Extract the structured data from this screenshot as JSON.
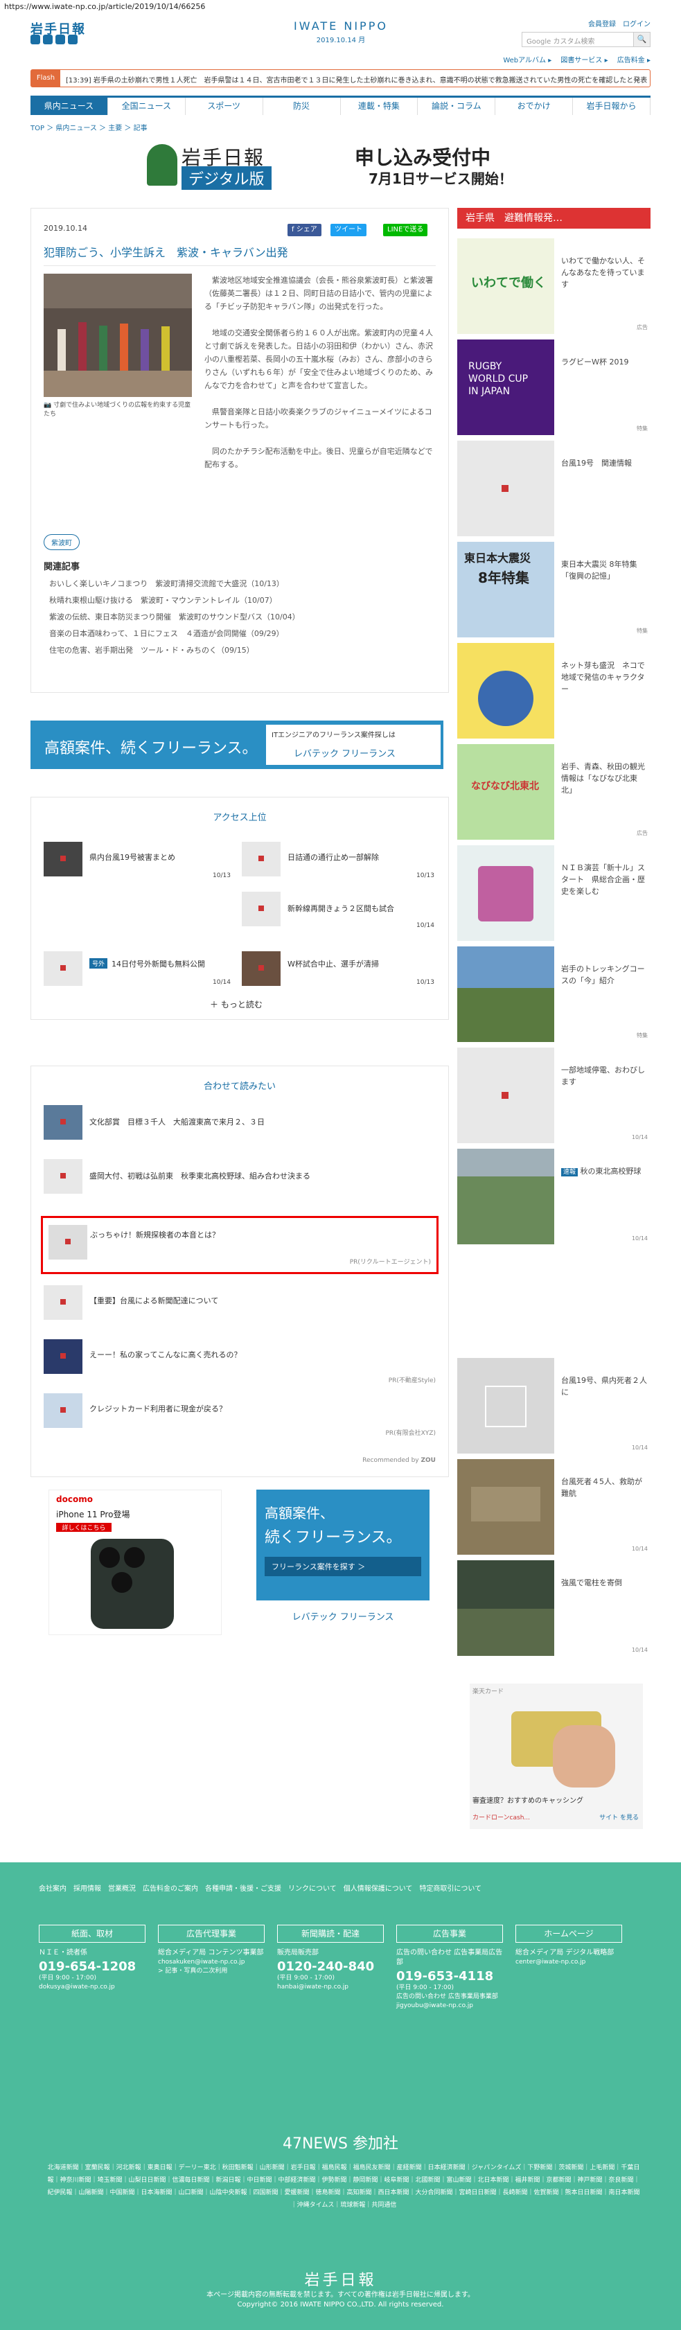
{
  "url": "https://www.iwate-np.co.jp/article/2019/10/14/66256",
  "header": {
    "logo": "岩手日報",
    "center_title": "IWATE NIPPO",
    "center_date": "2019.10.14 月",
    "member": "会員登録",
    "login": "ログイン",
    "search_placeholder": "Google カスタム検索",
    "search_btn": "🔍",
    "subnav": "Webアルバム ▸　 図書サービス ▸　 広告料金 ▸"
  },
  "flash": {
    "tag": "Flash",
    "text": "[13:39] 岩手県の土砂崩れで男性１人死亡　岩手県警は１４日、宮古市田老で１３日に発生した土砂崩れに巻き込まれ、意識不明の状態で救急搬送されていた男性の死亡を確認したと発表した。"
  },
  "nav": [
    "県内ニュース",
    "全国ニュース",
    "スポーツ",
    "防災",
    "連載・特集",
    "論説・コラム",
    "おでかけ",
    "岩手日報から"
  ],
  "breadcrumb": "TOP ＞ 県内ニュース ＞ 主要 ＞ 記事",
  "banner": {
    "left": "岩手日報",
    "left_sub": "デジタル版",
    "right1": "申し込み受付中",
    "right2": "7月1日サービス開始！"
  },
  "article": {
    "date": "2019.10.14",
    "title": "犯罪防ごう、小学生訴え　紫波・キャラバン出発",
    "share_fb": "f シェア",
    "share_tw": "ツイート",
    "share_line": "LINEで送る",
    "caption": "寸劇で住みよい地域づくりの広報を約束する児童たち",
    "body": "　紫波地区地域安全推進協議会（会長・熊谷泉紫波町長）と紫波署（佐藤英二署長）は１２日、同町日詰の日詰小で、管内の児童による「チビッ子防犯キャラバン隊」の出発式を行った。\n\n　地域の交通安全関係者ら約１６０人が出席。紫波町内の児童４人と寸劇で訴えを発表した。日詰小の羽田和伊（わかい）さん、赤沢小の八重樫若菜、長岡小の五十嵐水桜（みお）さん、彦部小のきらりさん（いずれも６年）が「安全で住みよい地域づくりのため、みんなで力を合わせて」と声を合わせて宣言した。\n\n　県警音楽隊と日詰小吹奏楽クラブのジャイニューメイツによるコンサートも行った。\n\n　同のたかチラシ配布活動を中止。後日、児童らが自宅近隣などで配布する。",
    "tag": "紫波町",
    "related_h": "関連記事",
    "related": [
      "おいしく楽しいキノコまつり　紫波町清掃交流館で大盛況（10/13）",
      "秋晴れ東根山駆け抜ける　紫波町・マウンテントレイル（10/07）",
      "紫波の伝統、東日本防災まつり開催　紫波町のサウンド型バス（10/04）",
      "音楽の日本酒味わって、１日にフェス　４酒造が会同開催（09/29）",
      "住宅の危害、岩手期出発　ツール・ド・みちのく（09/15）"
    ]
  },
  "ad1": {
    "text": "高額案件、続くフリーランス。",
    "right": "ITエンジニアのフリーランス案件探しは",
    "brand": "レバテック フリーランス"
  },
  "ranking": {
    "title": "アクセス上位",
    "items": [
      {
        "t": "県内台風19号被害まとめ",
        "d": "10/13"
      },
      {
        "t": "日詰通の通行止め一部解除",
        "d": "10/13"
      },
      {
        "t": "新幹線再開きょう２区間も試合",
        "d": "10/14"
      },
      {
        "t": "14日付号外新聞も無料公開",
        "d": "10/14"
      },
      {
        "t": "W杯試合中止、選手が清掃",
        "d": "10/13"
      }
    ],
    "more": "＋ もっと読む",
    "new_badge": "号外"
  },
  "recommend": {
    "title": "合わせて読みたい",
    "items": [
      {
        "t": "文化部賞　目標３千人　大船渡東高で来月２、３日"
      },
      {
        "t": "盛岡大付、初戦は弘前東　秋季東北高校野球、組み合わせ決まる"
      },
      {
        "t": "ぶっちゃけ！新規探検者の本音とは？",
        "pr": "PR(リクルートエージェント)"
      },
      {
        "t": "【重要】台風による新聞配達について"
      },
      {
        "t": "えーー！私の家ってこんなに高く売れるの？",
        "pr": "PR(不動産Style)"
      },
      {
        "t": "クレジットカード利用者に現金が戻る？",
        "pr": "PR(有限会社XYZ)"
      }
    ],
    "credit": "Recommended by",
    "credit_brand": "ZOU"
  },
  "ad_docomo": {
    "brand": "docomo",
    "title": "iPhone 11 Pro登場",
    "btn": "詳しくはこちら"
  },
  "ad2": {
    "t1": "高額案件、",
    "t2": "続くフリーランス。",
    "btn": "フリーランス案件を探す ＞",
    "brand": "レバテック フリーランス"
  },
  "sidebar": {
    "header": "岩手県　避難情報発…",
    "items": [
      {
        "t": "いわてで働かない人、そんなあなたを待っています",
        "tag": "広告",
        "img": "iwate"
      },
      {
        "t": "ラグビーＷ杯 2019",
        "tag": "特集",
        "img": "rugby"
      },
      {
        "t": "台風19号　関連情報",
        "tag": "",
        "img": "blank"
      },
      {
        "t": "東日本大震災 8年特集「復興の記憶」",
        "tag": "特集",
        "img": "shinsai"
      },
      {
        "t": "ネット芽も盛況　ネコで地域で発信のキャラクター",
        "tag": "",
        "img": "iwa"
      },
      {
        "t": "岩手、青森、秋田の観光情報は「なびなび北東北」",
        "tag": "広告",
        "img": "navi"
      },
      {
        "t": "ＮＩＢ演芸「新十ル」スタート　県総合企画・歴史を楽しむ",
        "tag": "",
        "img": "nib"
      },
      {
        "t": "岩手のトレッキングコースの「今」紹介",
        "tag": "特集",
        "img": "mountain"
      },
      {
        "t": "一部地域停電、おわびします",
        "tag": "",
        "date": "10/14",
        "img": "blank"
      },
      {
        "t": "秋の東北高校野球",
        "tag": "速報",
        "date": "10/14",
        "img": "baseball"
      },
      {
        "t": "台風19号、県内死者２人に",
        "tag": "",
        "date": "10/14",
        "img": "logo"
      },
      {
        "t": "台風死者４5人、救助が難航",
        "tag": "",
        "date": "10/14",
        "img": "flood"
      },
      {
        "t": "強風で電柱を寄倒",
        "tag": "",
        "date": "10/14",
        "img": "road"
      }
    ]
  },
  "sidead": {
    "title": "楽天カード",
    "sub": "審査速度？おすすめのキャッシング",
    "brand": "カードローンcash...",
    "foot": "サイト を見る"
  },
  "footer": {
    "links": "会社案内　採用情報　営業概況　広告料金のご案内　各種申請・後援・ご支援　リンクについて　個人情報保護について　特定商取引について",
    "cols": [
      {
        "h": "紙面、取材",
        "s": "ＮＩＥ・読者係",
        "ph": "019-654-1208",
        "sm": "(平日 9:00 - 17:00)",
        "mail": "dokusya@iwate-np.co.jp"
      },
      {
        "h": "広告代理事業",
        "s": "総合メディア局 コンテンツ事業部",
        "ph": "",
        "sm": "chosakuken@iwate-np.co.jp",
        "mail": "> 記事・写真の二次利用"
      },
      {
        "h": "新聞購読・配達",
        "s": "販売局販売部",
        "ph": "0120-240-840",
        "sm": "(平日 9:00 - 17:00)",
        "mail": "hanbai@iwate-np.co.jp"
      },
      {
        "h": "広告事業",
        "s": "広告の問い合わせ 広告事業局広告部",
        "ph": "019-653-4118",
        "sm": "(平日 9:00 - 17:00)",
        "mail": "広告の問い合わせ 広告事業局事業部 jigyoubu@iwate-np.co.jp"
      },
      {
        "h": "ホームページ",
        "s": "総合メディア局 デジタル戦略部",
        "ph": "",
        "sm": "center@iwate-np.co.jp",
        "mail": ""
      }
    ],
    "news47": "47NEWS 参加社",
    "members": "北海道新聞｜室蘭民報｜河北新報｜東奥日報｜デーリー東北｜秋田魁新報｜山形新聞｜岩手日報｜福島民報｜福島民友新聞｜産経新聞｜日本経済新聞｜ジャパンタイムズ｜下野新聞｜茨城新聞｜上毛新聞｜千葉日報｜神奈川新聞｜埼玉新聞｜山梨日日新聞｜信濃毎日新聞｜新潟日報｜中日新聞｜中部経済新聞｜伊勢新聞｜静岡新聞｜岐阜新聞｜北國新聞｜富山新聞｜北日本新聞｜福井新聞｜京都新聞｜神戸新聞｜奈良新聞｜紀伊民報｜山陽新聞｜中国新聞｜日本海新聞｜山口新聞｜山陰中央新報｜四国新聞｜愛媛新聞｜徳島新聞｜高知新聞｜西日本新聞｜大分合同新聞｜宮崎日日新聞｜長崎新聞｜佐賀新聞｜熊本日日新聞｜南日本新聞｜沖縄タイムス｜琉球新報｜共同通信",
    "logo": "岩手日報",
    "copy1": "本ページ掲載内容の無断転載を禁じます。すべての著作権は岩手日報社に帰属します。",
    "copy2": "Copyright© 2016 IWATE NIPPO CO.,LTD. All rights reserved."
  }
}
